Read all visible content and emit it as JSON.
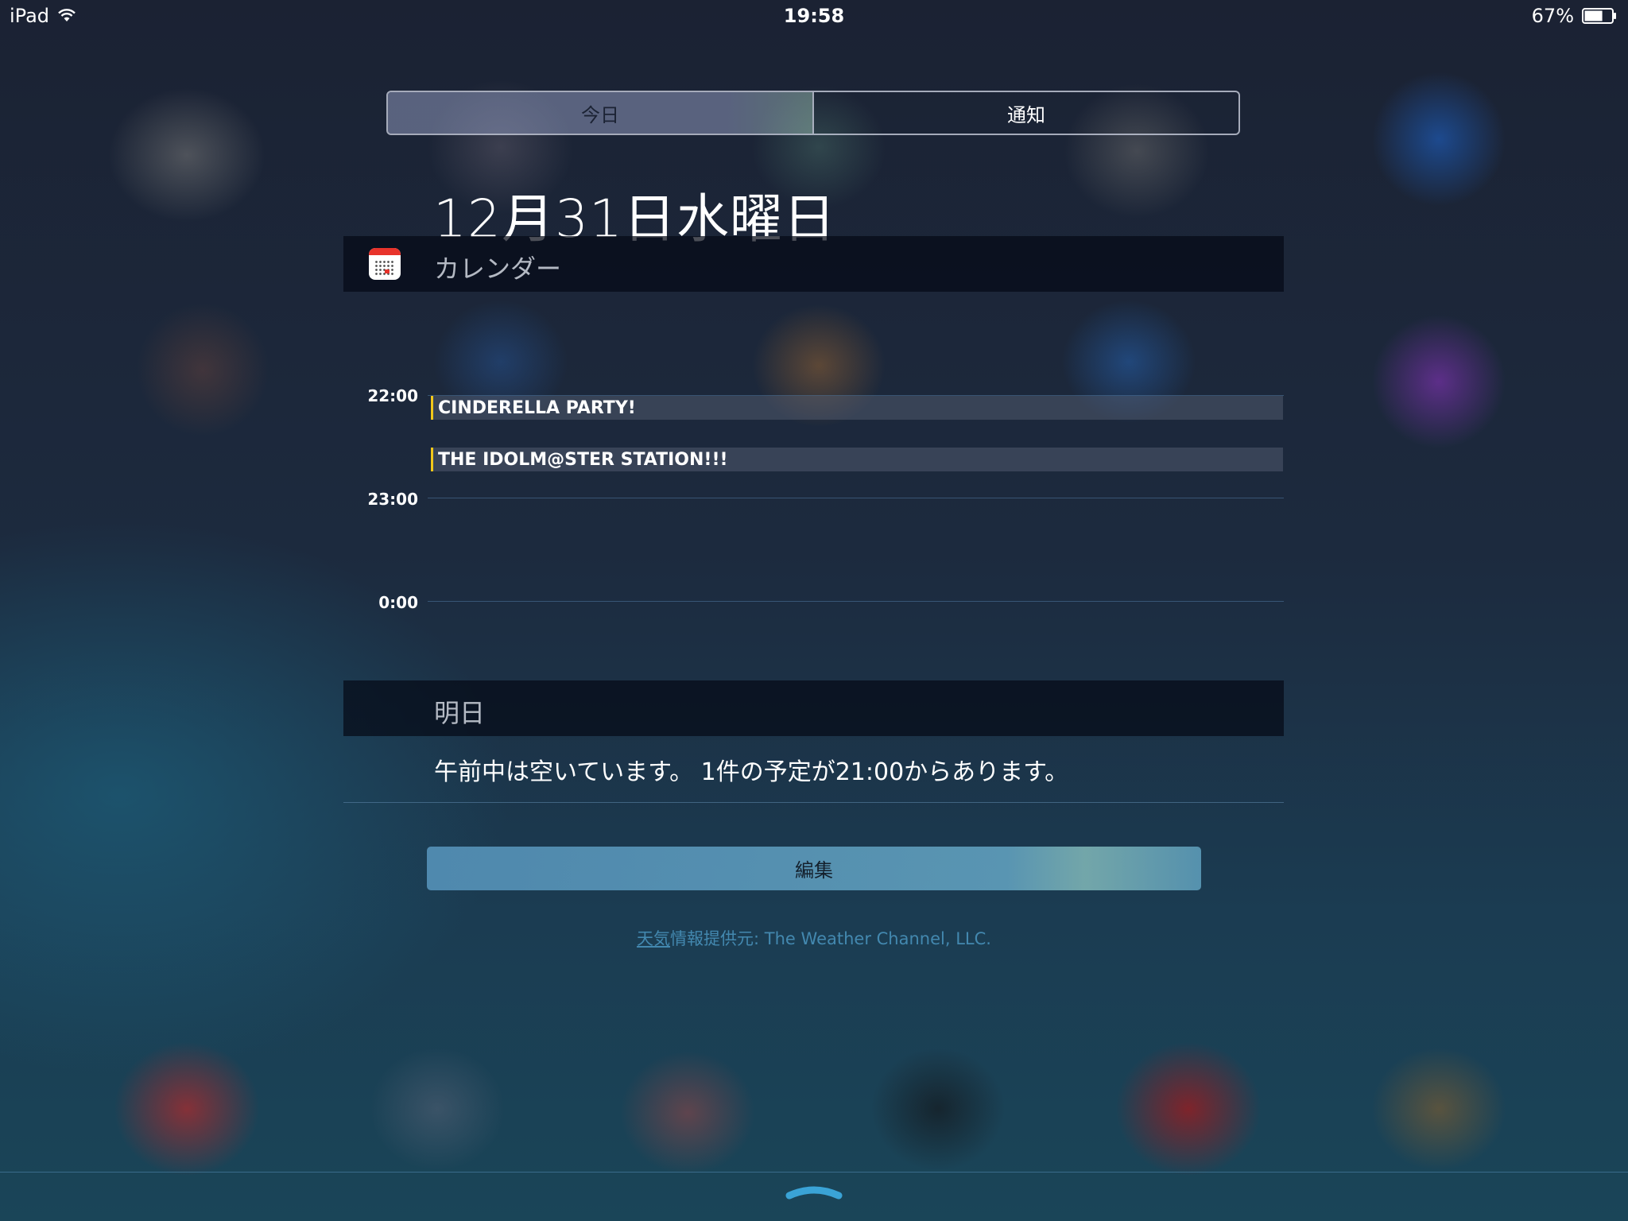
{
  "status_bar": {
    "carrier": "iPad",
    "time": "19:58",
    "battery_percent": "67%",
    "battery_level": 0.67,
    "icons": [
      "wifi-icon",
      "battery-icon"
    ]
  },
  "segment": {
    "tabs": [
      {
        "label": "今日",
        "selected": true
      },
      {
        "label": "通知",
        "selected": false
      }
    ]
  },
  "date_title": "12月31日水曜日",
  "calendar": {
    "header": "カレンダー",
    "icon": "calendar-app-icon",
    "hours": [
      "22:00",
      "23:00",
      "0:00"
    ],
    "events": [
      {
        "title": "CINDERELLA PARTY!"
      },
      {
        "title": "THE IDOLM@STER STATION!!!"
      }
    ]
  },
  "tomorrow": {
    "header": "明日",
    "summary": "午前中は空いています。 1件の予定が21:00からあります。"
  },
  "edit_button": {
    "label": "編集"
  },
  "credit": {
    "link": "天気",
    "text": "情報提供元: The Weather Channel, LLC."
  },
  "colors": {
    "event_accent": "#f2c81a",
    "edit_button": "#5896be",
    "credit": "#468cb4"
  }
}
